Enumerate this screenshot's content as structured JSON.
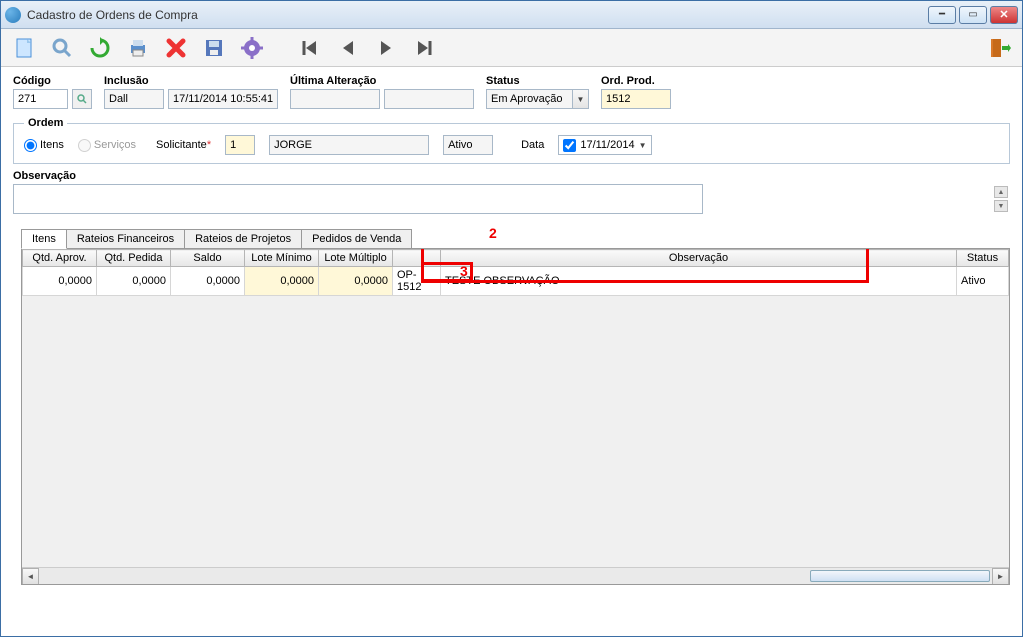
{
  "window": {
    "title": "Cadastro de Ordens de Compra"
  },
  "toolbar": {
    "new": "new-icon",
    "search": "search-icon",
    "refresh": "refresh-icon",
    "print": "print-icon",
    "delete": "delete-icon",
    "save": "save-icon",
    "settings": "settings-icon",
    "first": "first-icon",
    "prev": "prev-icon",
    "next": "next-icon",
    "last": "last-icon",
    "exit": "exit-icon"
  },
  "form": {
    "codigo_label": "Código",
    "codigo_value": "271",
    "inclusao_label": "Inclusão",
    "inclusao_user": "Dall",
    "inclusao_date": "17/11/2014 10:55:41",
    "ultima_label": "Última Alteração",
    "ultima_user": "",
    "ultima_date": "",
    "status_label": "Status",
    "status_value": "Em Aprovação",
    "ordprod_label": "Ord. Prod.",
    "ordprod_value": "1512",
    "ordem_legend": "Ordem",
    "radio_itens": "Itens",
    "radio_servicos": "Serviços",
    "solicitante_label": "Solicitante",
    "solicitante_code": "1",
    "solicitante_name": "JORGE",
    "solicitante_status": "Ativo",
    "data_label": "Data",
    "data_value": "17/11/2014",
    "observacao_label": "Observação",
    "observacao_value": ""
  },
  "tabs": {
    "itens": "Itens",
    "rateios_fin": "Rateios Financeiros",
    "rateios_proj": "Rateios de Projetos",
    "pedidos": "Pedidos de Venda"
  },
  "annotations": {
    "two": "2",
    "three": "3"
  },
  "grid": {
    "headers": {
      "qtd_aprov": "Qtd. Aprov.",
      "qtd_pedida": "Qtd. Pedida",
      "saldo": "Saldo",
      "lote_min": "Lote Mínimo",
      "lote_mult": "Lote Múltiplo",
      "op": "",
      "observacao": "Observação",
      "status": "Status"
    },
    "rows": [
      {
        "qtd_aprov": "0,0000",
        "qtd_pedida": "0,0000",
        "saldo": "0,0000",
        "lote_min": "0,0000",
        "lote_mult": "0,0000",
        "op": "OP-1512",
        "observacao": "TESTE OBSERVAÇÃO",
        "status": "Ativo"
      }
    ]
  }
}
